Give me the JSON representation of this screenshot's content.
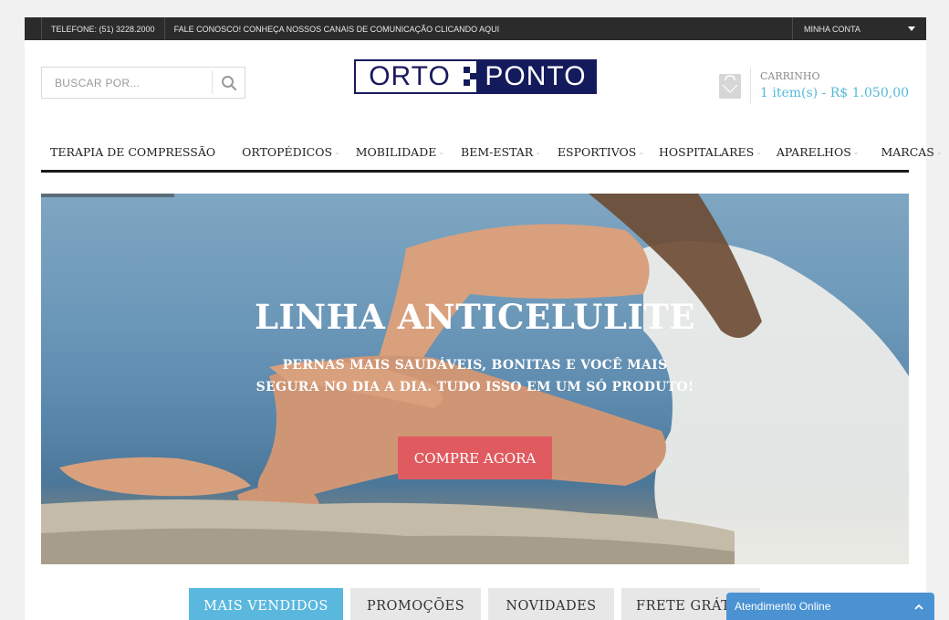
{
  "topbar": {
    "phone": "TELEFONE: (51) 3228.2000",
    "contact": "FALE CONOSCO! CONHEÇA NOSSOS CANAIS DE COMUNICAÇÃO CLICANDO AQUI",
    "account": "MINHA CONTA"
  },
  "search": {
    "placeholder": "BUSCAR POR..."
  },
  "logo": {
    "left": "ORTO",
    "right": "PONTO"
  },
  "cart": {
    "label": "CARRINHO",
    "total": "1 item(s) - R$ 1.050,00"
  },
  "nav": {
    "items": [
      {
        "label": "TERAPIA DE COMPRESSÃO"
      },
      {
        "label": "ORTOPÉDICOS"
      },
      {
        "label": "MOBILIDADE"
      },
      {
        "label": "BEM-ESTAR"
      },
      {
        "label": "ESPORTIVOS"
      },
      {
        "label": "HOSPITALARES"
      },
      {
        "label": "APARELHOS"
      },
      {
        "label": "MARCAS"
      }
    ]
  },
  "hero": {
    "title": "LINHA ANTICELULITE",
    "subtitle": "PERNAS MAIS SAUDÁVEIS, BONITAS E VOCÊ MAIS SEGURA NO DIA A DIA. TUDO ISSO EM UM SÓ PRODUTO!",
    "cta": "COMPRE AGORA"
  },
  "tabs": [
    {
      "label": "MAIS VENDIDOS"
    },
    {
      "label": "PROMOÇÕES"
    },
    {
      "label": "NOVIDADES"
    },
    {
      "label": "FRETE GRÁTIS"
    }
  ],
  "chat": {
    "label": "Atendimento Online"
  },
  "colors": {
    "topbar": "#2b2b2b",
    "accent_blue": "#5ab8de",
    "cta_red": "#e05b60",
    "logo_navy": "#141b5c",
    "chat_blue": "#4a92d2"
  }
}
